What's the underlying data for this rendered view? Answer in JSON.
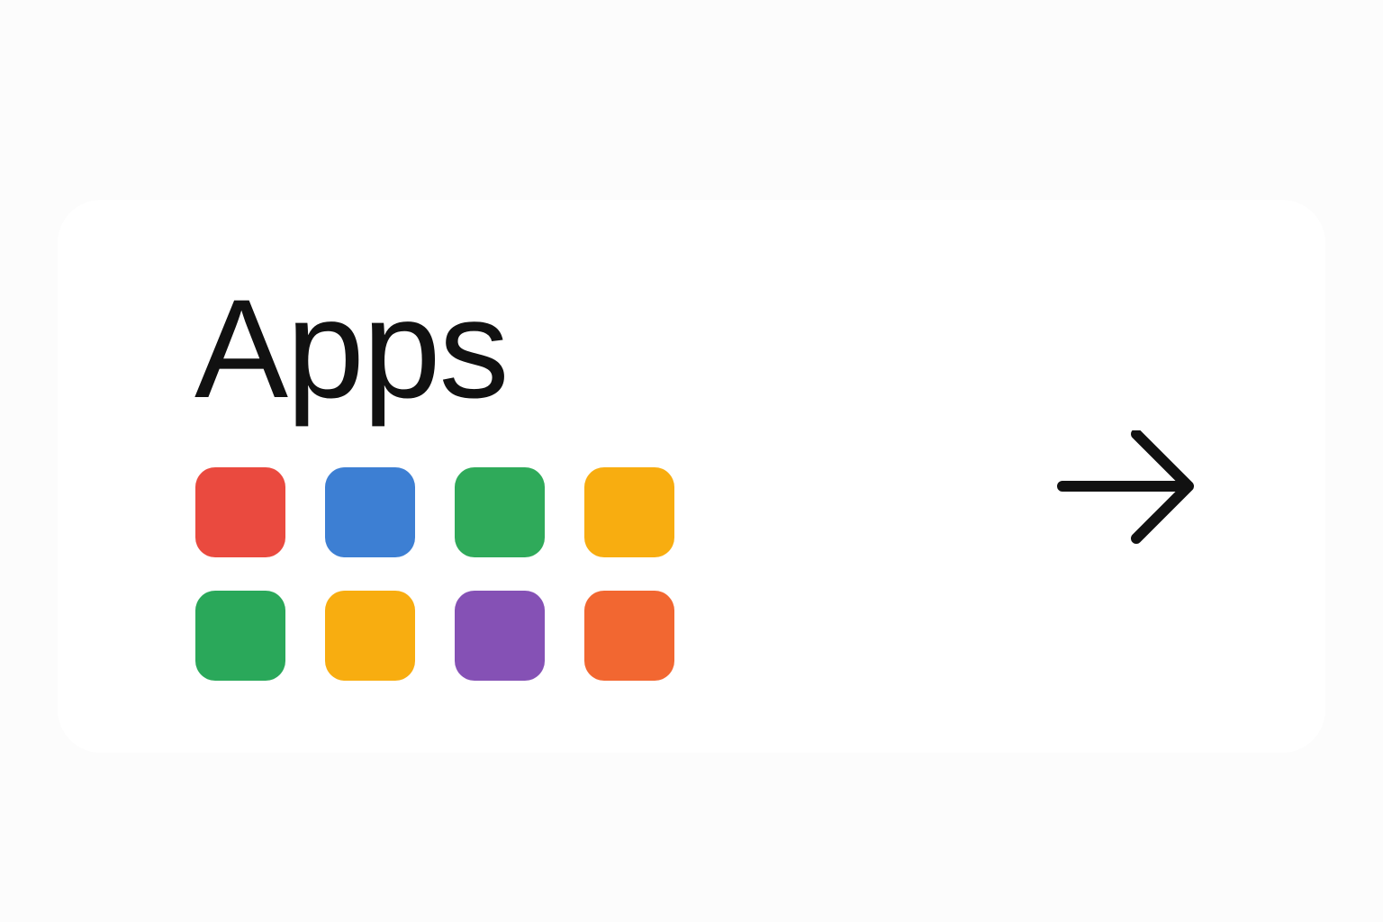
{
  "card": {
    "title": "Apps"
  },
  "tiles": [
    {
      "icon": "app-tile",
      "color": "#ea4a3f"
    },
    {
      "icon": "app-tile",
      "color": "#3d7fd3"
    },
    {
      "icon": "app-tile",
      "color": "#2faa5a"
    },
    {
      "icon": "app-tile",
      "color": "#f8ad10"
    },
    {
      "icon": "app-tile",
      "color": "#2aa85a"
    },
    {
      "icon": "app-tile",
      "color": "#f8ad10"
    },
    {
      "icon": "app-tile",
      "color": "#8551b5"
    },
    {
      "icon": "app-tile",
      "color": "#f26731"
    }
  ],
  "arrow": {
    "icon": "arrow-right-icon",
    "color": "#111111"
  },
  "colors": {
    "page_background": "#fcfcfc",
    "card_background": "#ffffff",
    "text": "#111111"
  }
}
